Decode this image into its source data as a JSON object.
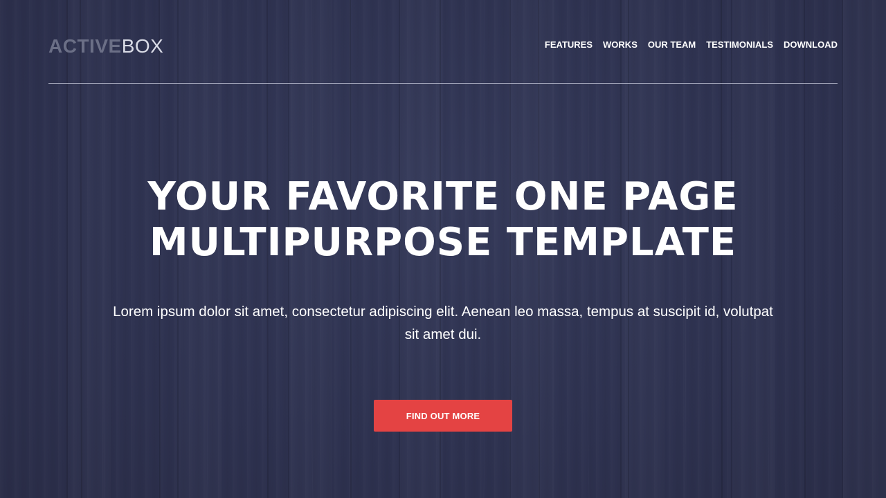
{
  "colors": {
    "background": "#2f3350",
    "accent_button": "#e44343",
    "logo_bold": "#6b6f86",
    "logo_light": "#d9dbe6",
    "text": "#ffffff"
  },
  "header": {
    "logo": {
      "bold": "ACTIVE",
      "light": "BOX"
    },
    "nav": [
      {
        "label": "FEATURES"
      },
      {
        "label": "WORKS"
      },
      {
        "label": "OUR TEAM"
      },
      {
        "label": "TESTIMONIALS"
      },
      {
        "label": "DOWNLOAD"
      }
    ]
  },
  "hero": {
    "headline_line1": "YOUR FAVORITE ONE PAGE",
    "headline_line2": "MULTIPURPOSE TEMPLATE",
    "lead": "Lorem ipsum dolor sit amet, consectetur adipiscing elit. Aenean leo massa, tempus at suscipit id, volutpat sit amet dui.",
    "cta_label": "FIND OUT MORE"
  }
}
